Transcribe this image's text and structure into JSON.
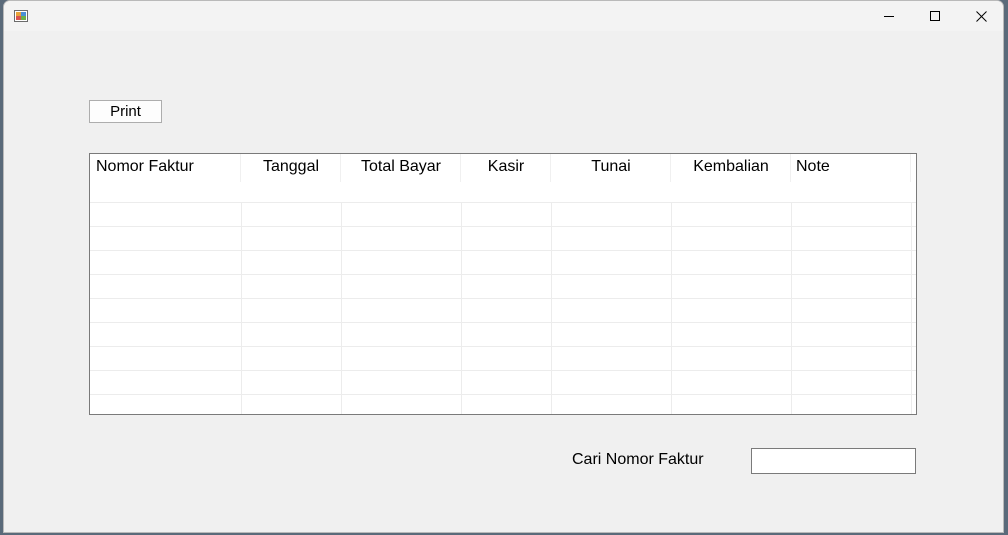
{
  "window": {
    "controls": {
      "minimize_icon": "minimize-icon",
      "maximize_icon": "maximize-icon",
      "close_icon": "close-icon"
    }
  },
  "toolbar": {
    "print_label": "Print"
  },
  "table": {
    "columns": [
      "Nomor Faktur",
      "Tanggal",
      "Total Bayar",
      "Kasir",
      "Tunai",
      "Kembalian",
      "Note"
    ],
    "rows": []
  },
  "search": {
    "label": "Cari Nomor Faktur",
    "value": ""
  },
  "colors": {
    "window_bg": "#f0f0f0",
    "grid_bg": "#ffffff",
    "grid_border": "#7a7a7a"
  }
}
